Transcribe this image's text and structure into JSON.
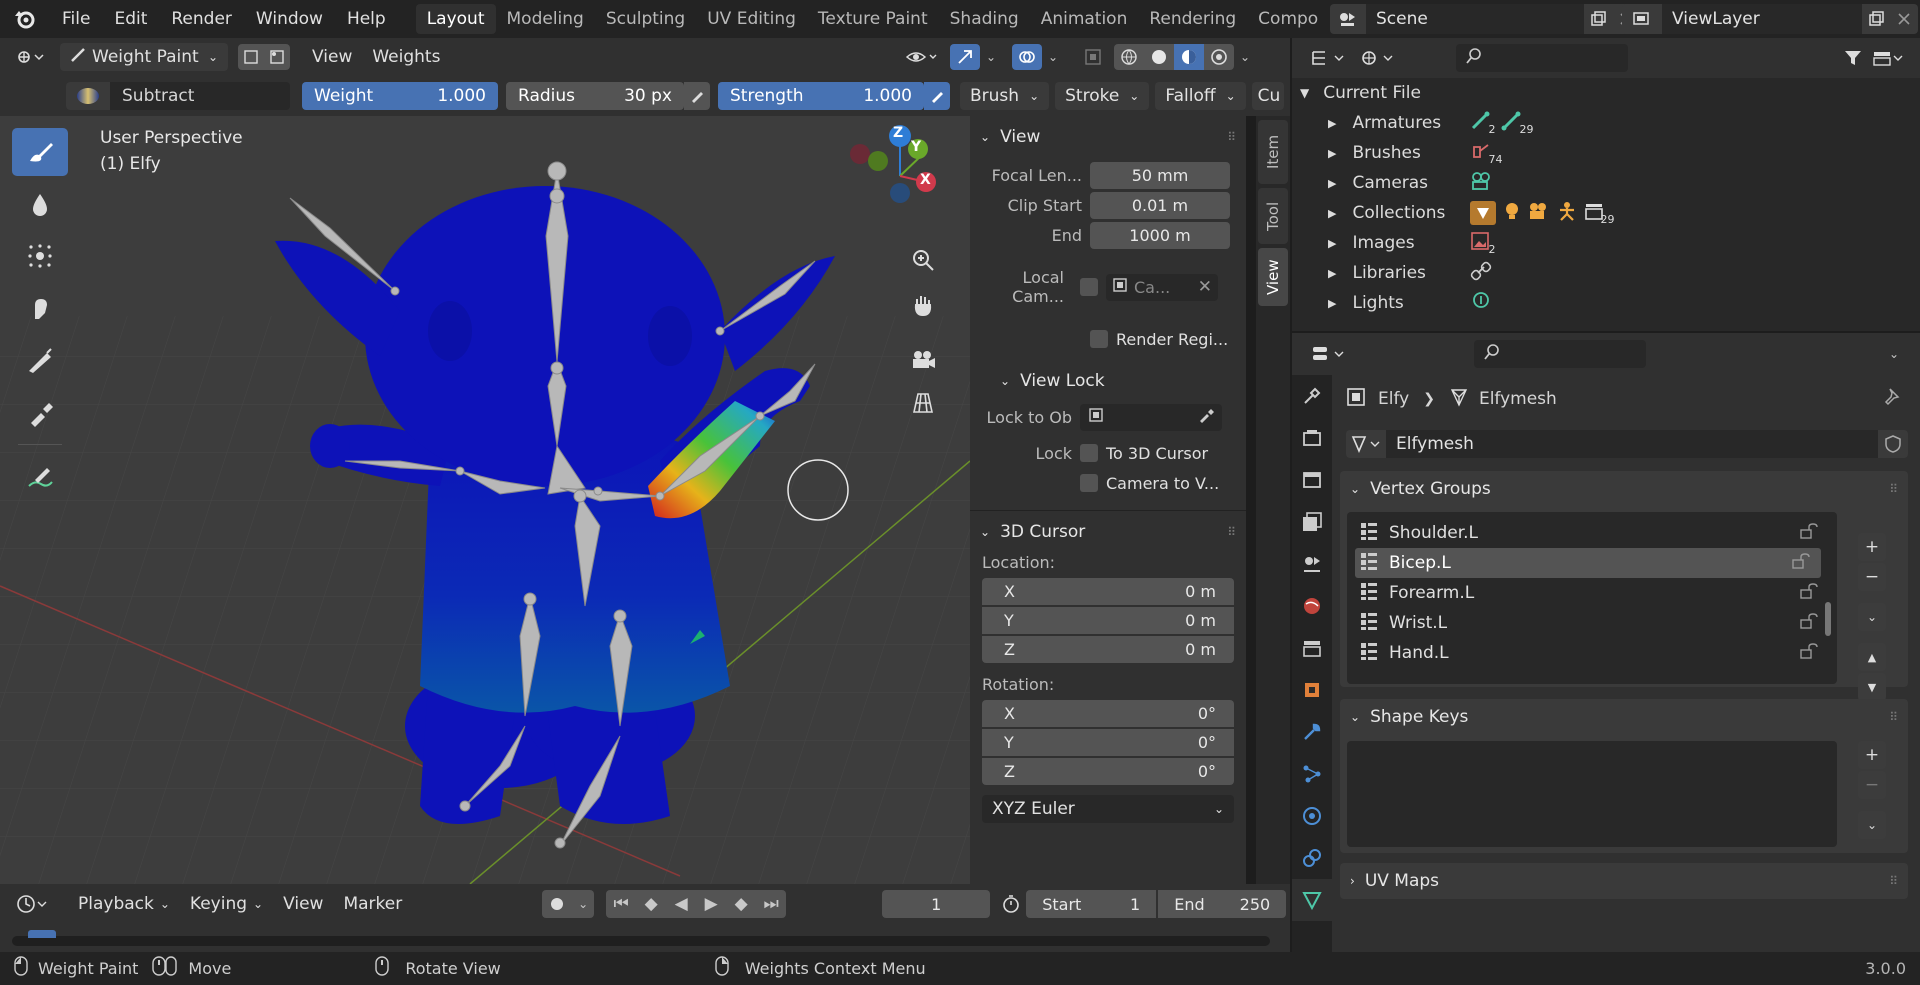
{
  "menu": {
    "items": [
      "File",
      "Edit",
      "Render",
      "Window",
      "Help"
    ],
    "workspaces": [
      "Layout",
      "Modeling",
      "Sculpting",
      "UV Editing",
      "Texture Paint",
      "Shading",
      "Animation",
      "Rendering",
      "Compo"
    ],
    "active_workspace": "Layout",
    "scene": "Scene",
    "view_layer": "ViewLayer"
  },
  "viewport_header": {
    "mode": "Weight Paint",
    "view_menu": "View",
    "weights_menu": "Weights"
  },
  "tool_settings": {
    "blend": "Subtract",
    "weight_label": "Weight",
    "weight_value": "1.000",
    "radius_label": "Radius",
    "radius_value": "30 px",
    "strength_label": "Strength",
    "strength_value": "1.000",
    "brush": "Brush",
    "stroke": "Stroke",
    "falloff": "Falloff",
    "cursor_trunc": "Cu"
  },
  "viewport": {
    "perspective": "User Perspective",
    "object": "(1) Elfy",
    "gizmo": {
      "x": "X",
      "y": "Y",
      "z": "Z"
    }
  },
  "npanel": {
    "tabs": [
      "Item",
      "Tool",
      "View"
    ],
    "active_tab": "View",
    "view_section": "View",
    "focal_label": "Focal Len...",
    "focal_value": "50 mm",
    "clip_start_label": "Clip Start",
    "clip_start_value": "0.01 m",
    "clip_end_label": "End",
    "clip_end_value": "1000 m",
    "local_cam_label": "Local Cam...",
    "local_cam_value": "Ca...",
    "render_region": "Render Regi...",
    "view_lock_section": "View Lock",
    "lock_to_ob_label": "Lock to Ob",
    "lock_label": "Lock",
    "to_3d_cursor": "To 3D Cursor",
    "camera_to_view": "Camera to V...",
    "cursor_section": "3D Cursor",
    "location_label": "Location:",
    "loc": [
      {
        "axis": "X",
        "value": "0 m"
      },
      {
        "axis": "Y",
        "value": "0 m"
      },
      {
        "axis": "Z",
        "value": "0 m"
      }
    ],
    "rotation_label": "Rotation:",
    "rot": [
      {
        "axis": "X",
        "value": "0°"
      },
      {
        "axis": "Y",
        "value": "0°"
      },
      {
        "axis": "Z",
        "value": "0°"
      }
    ],
    "rotation_mode": "XYZ Euler"
  },
  "timeline": {
    "playback": "Playback",
    "keying": "Keying",
    "view": "View",
    "marker": "Marker",
    "current_frame": "1",
    "start_label": "Start",
    "start_value": "1",
    "end_label": "End",
    "end_value": "250"
  },
  "statusbar": {
    "left_action": "Weight Paint",
    "middle_action": "Move",
    "right_action": "Rotate View",
    "context": "Weights Context Menu",
    "version": "3.0.0"
  },
  "outliner": {
    "root": "Current File",
    "items": [
      {
        "label": "Armatures",
        "badges": [
          "2",
          "29"
        ]
      },
      {
        "label": "Brushes",
        "badges": [
          "74"
        ]
      },
      {
        "label": "Cameras",
        "badges": []
      },
      {
        "label": "Collections",
        "badges": [
          "29"
        ]
      },
      {
        "label": "Images",
        "badges": [
          "2"
        ]
      },
      {
        "label": "Libraries",
        "badges": []
      },
      {
        "label": "Lights",
        "badges": []
      }
    ]
  },
  "properties": {
    "object": "Elfy",
    "mesh": "Elfymesh",
    "datablock": "Elfymesh",
    "vertex_groups_section": "Vertex Groups",
    "vertex_groups": [
      "Shoulder.L",
      "Bicep.L",
      "Forearm.L",
      "Wrist.L",
      "Hand.L"
    ],
    "selected_group": "Bicep.L",
    "shape_keys_section": "Shape Keys",
    "uv_maps_section": "UV Maps"
  },
  "colors": {
    "accent": "#4772b3",
    "mesh_blue": "#0d12b8"
  }
}
